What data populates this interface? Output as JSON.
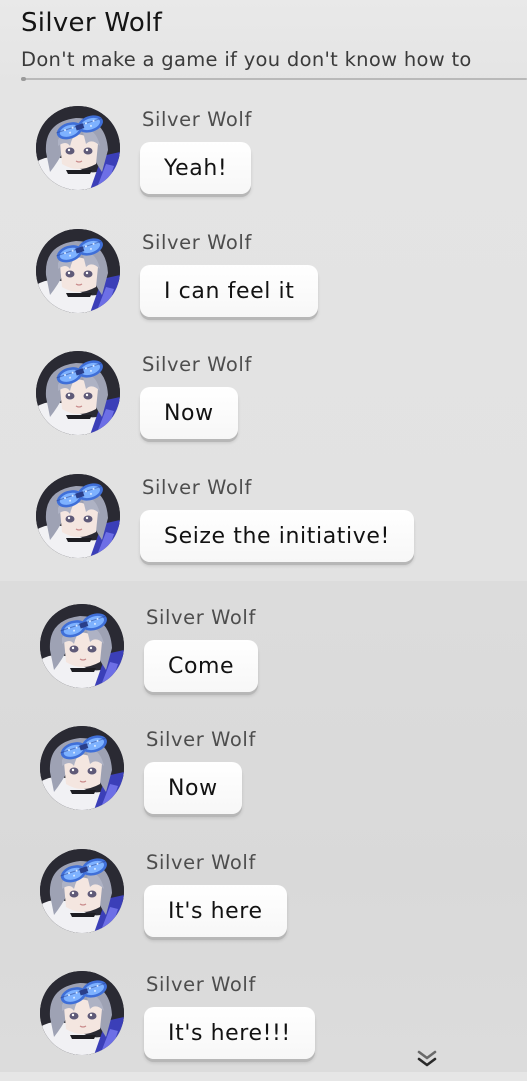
{
  "header": {
    "title": "Silver Wolf",
    "subtitle": "Don't make a game if you don't know how to"
  },
  "messages": [
    {
      "sender": "Silver Wolf",
      "text": "Yeah!"
    },
    {
      "sender": "Silver Wolf",
      "text": "I can feel it"
    },
    {
      "sender": "Silver Wolf",
      "text": "Now"
    },
    {
      "sender": "Silver Wolf",
      "text": "Seize the initiative!"
    },
    {
      "sender": "Silver Wolf",
      "text": "Come"
    },
    {
      "sender": "Silver Wolf",
      "text": "Now"
    },
    {
      "sender": "Silver Wolf",
      "text": "It's here"
    },
    {
      "sender": "Silver Wolf",
      "text": "It's here!!!"
    }
  ],
  "icons": {
    "avatar": "silver-wolf-avatar",
    "scroll_down": "double-chevron-down-icon"
  },
  "colors": {
    "bubble": "#ffffff",
    "background": "#e2e2e2",
    "goggles": "#3f6fd8"
  }
}
